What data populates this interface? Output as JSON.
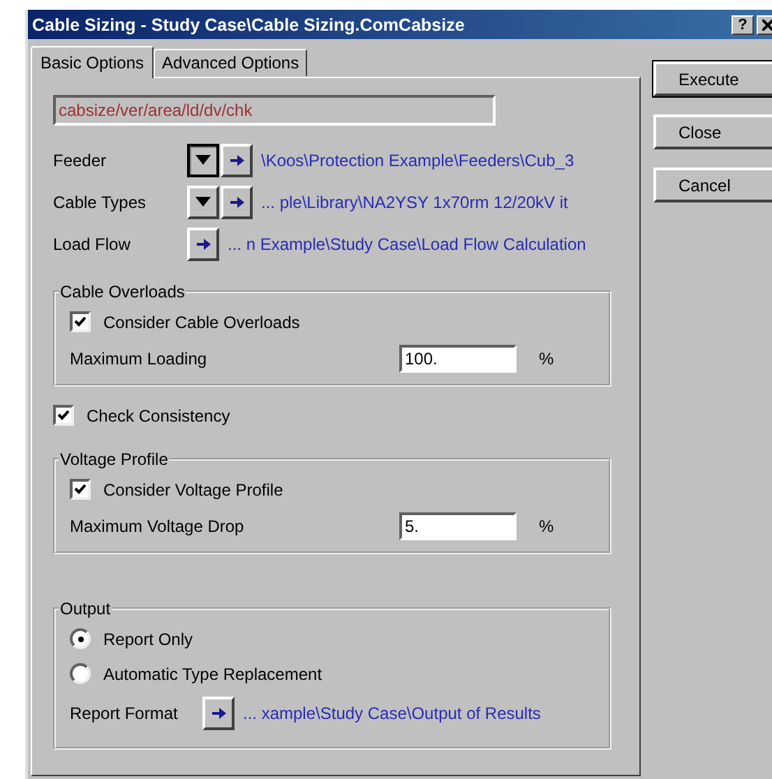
{
  "window": {
    "title": "Cable Sizing - Study Case\\Cable Sizing.ComCabsize",
    "help": "?"
  },
  "tabs": [
    {
      "label": "Basic Options",
      "selected": true
    },
    {
      "label": "Advanced Options",
      "selected": false
    }
  ],
  "command": "cabsize/ver/area/ld/dv/chk",
  "references": [
    {
      "label": "Feeder",
      "kind": "dropdown",
      "pressed": true,
      "path": "\\Koos\\Protection Example\\Feeders\\Cub_3"
    },
    {
      "label": "Cable Types",
      "kind": "dropdown",
      "pressed": false,
      "path": "... ple\\Library\\NA2YSY 1x70rm 12/20kV it"
    },
    {
      "label": "Load Flow",
      "kind": "plain",
      "path": "... n Example\\Study Case\\Load Flow Calculation"
    }
  ],
  "cable_overloads": {
    "title": "Cable Overloads",
    "checkbox": {
      "label": "Consider Cable Overloads",
      "checked": true
    },
    "field": {
      "label": "Maximum Loading",
      "value": "100.",
      "unit": "%"
    }
  },
  "check_consistency": {
    "label": "Check Consistency",
    "checked": true
  },
  "voltage_profile": {
    "title": "Voltage Profile",
    "checkbox": {
      "label": "Consider Voltage Profile",
      "checked": true
    },
    "field": {
      "label": "Maximum Voltage Drop",
      "value": "5.",
      "unit": "%"
    }
  },
  "output": {
    "title": "Output",
    "options": [
      {
        "label": "Report Only",
        "selected": true
      },
      {
        "label": "Automatic Type Replacement",
        "selected": false
      }
    ],
    "report_format": {
      "label": "Report Format",
      "path": "... xample\\Study Case\\Output of Results"
    }
  },
  "buttons": [
    "Execute",
    "Close",
    "Cancel"
  ]
}
